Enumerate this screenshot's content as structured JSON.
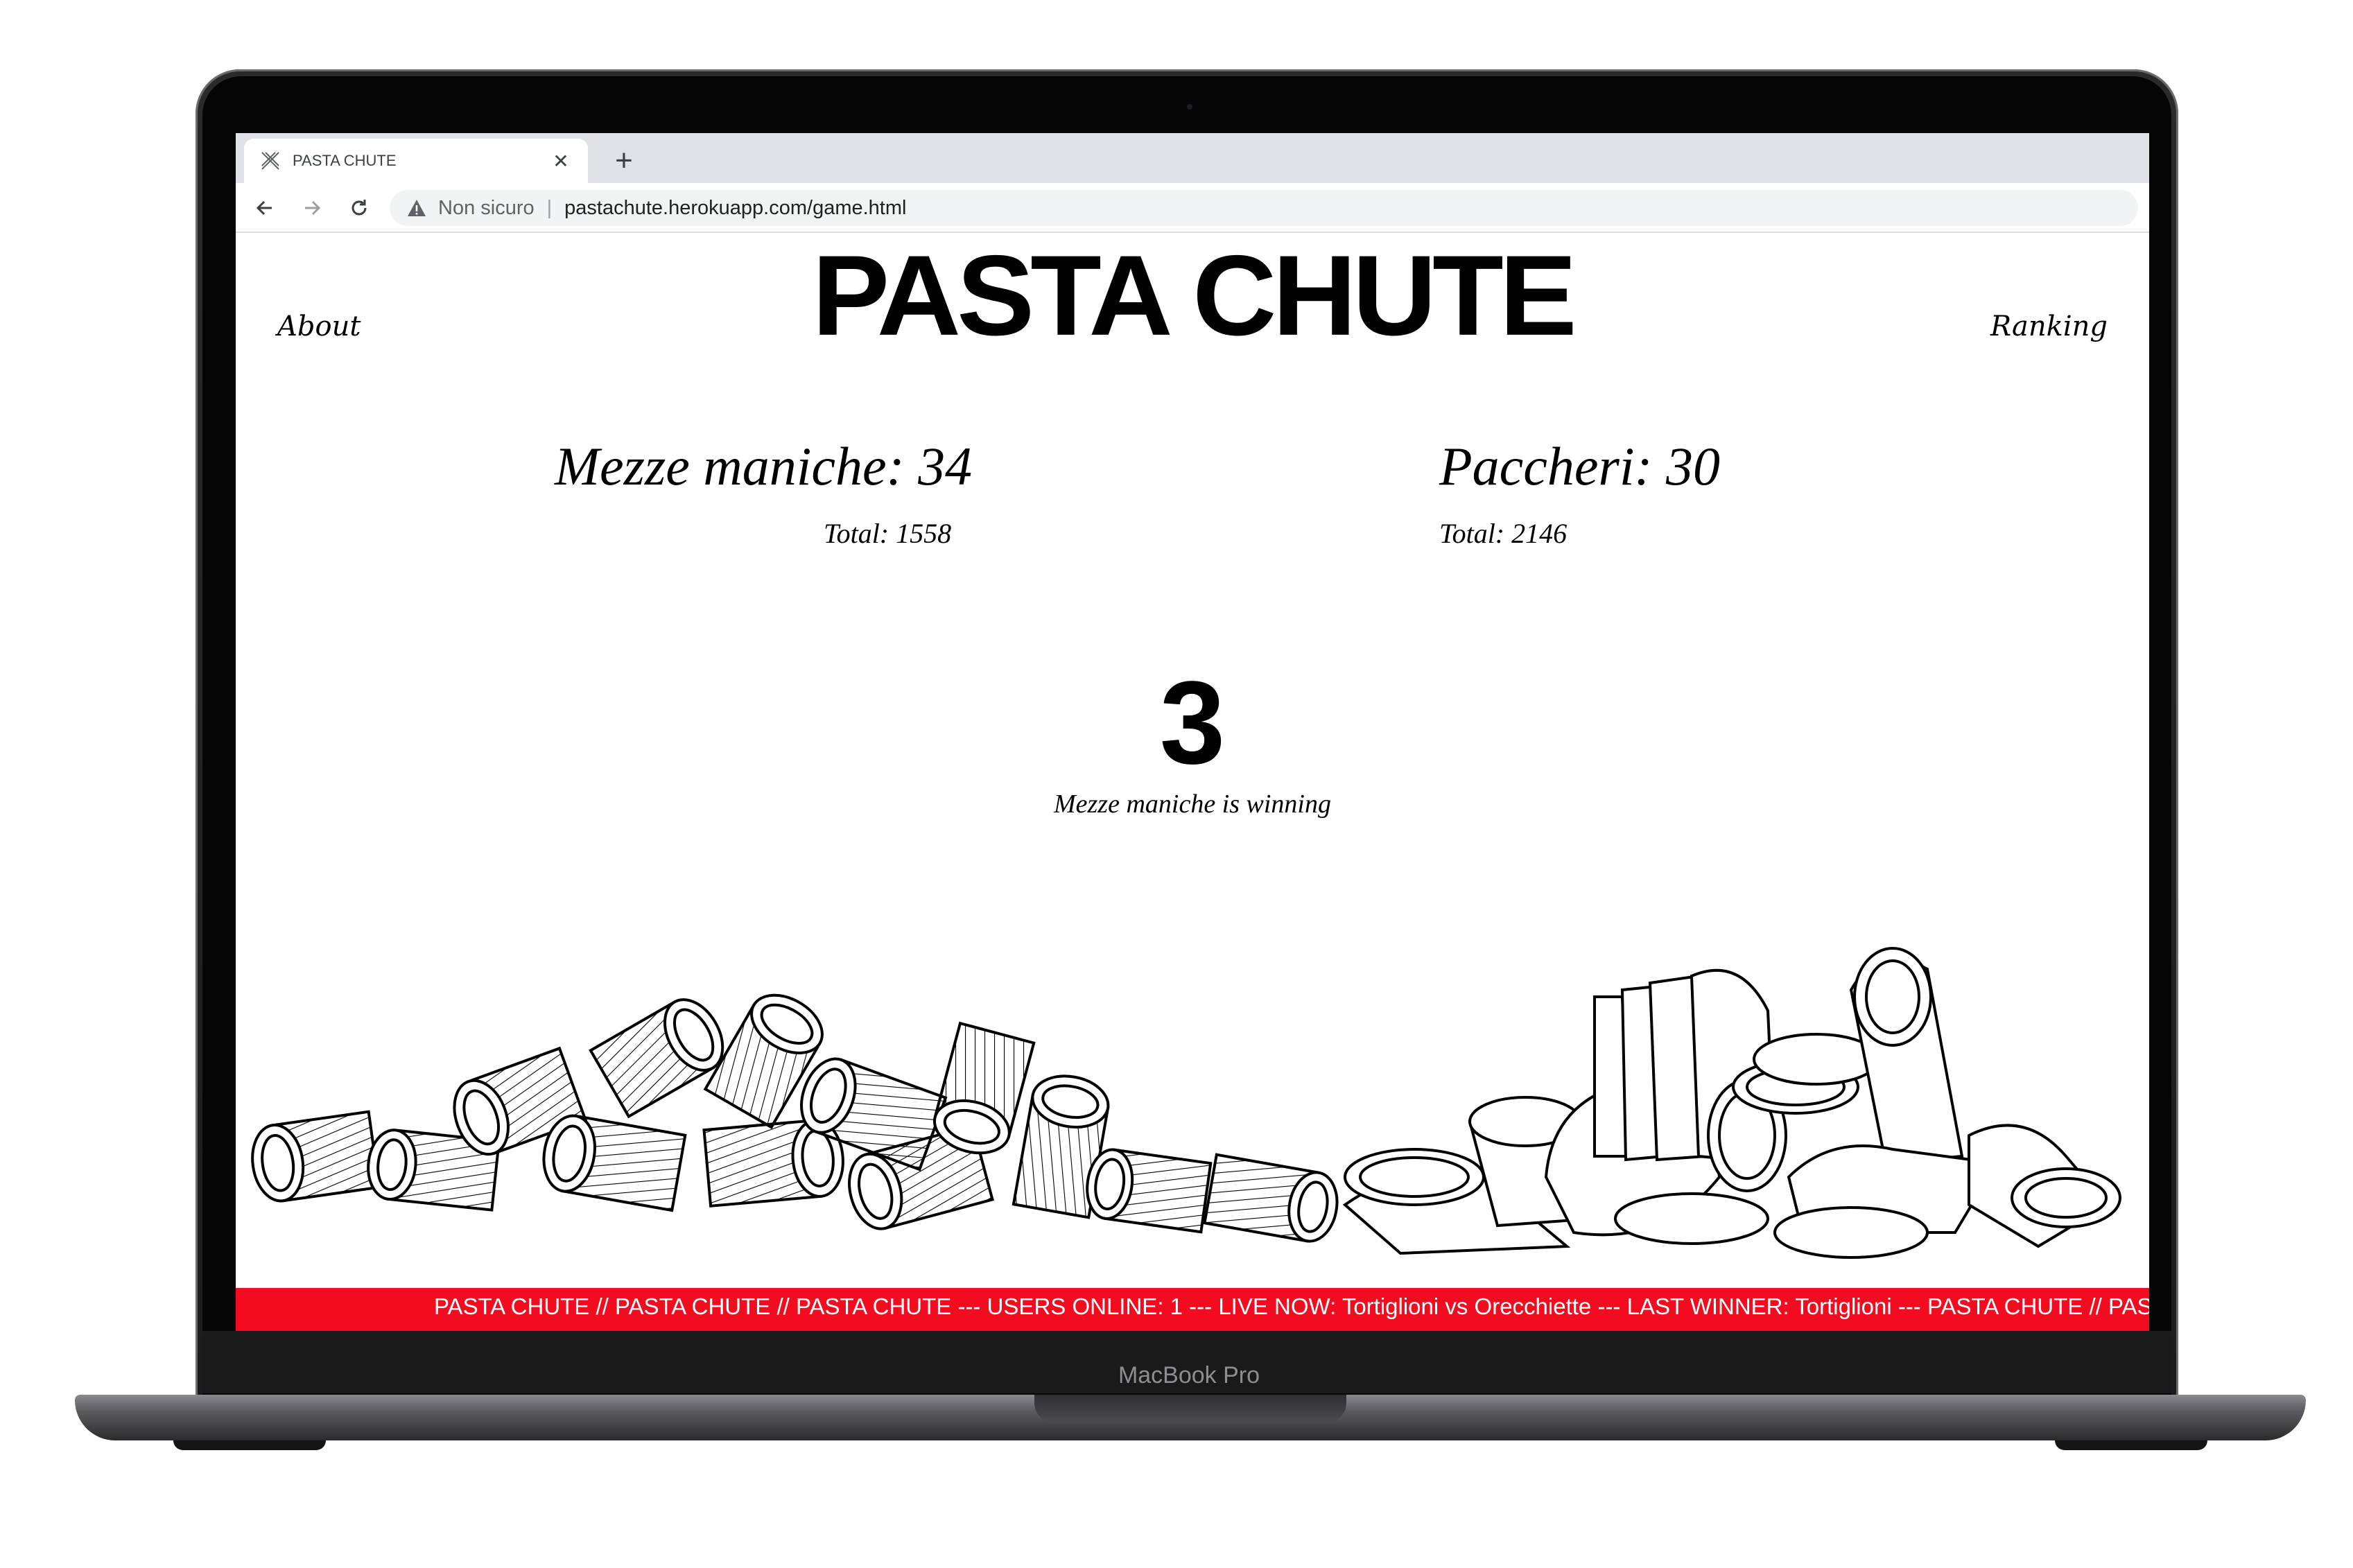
{
  "browser": {
    "tab_title": "PASTA CHUTE",
    "security_label": "Non sicuro",
    "url": "pastachute.herokuapp.com/game.html"
  },
  "header": {
    "brand": "PASTA CHUTE",
    "nav_left": "About",
    "nav_right": "Ranking"
  },
  "match": {
    "left_team": "Mezze maniche: 34",
    "left_total": "Total: 1558",
    "right_team": "Paccheri: 30",
    "right_total": "Total: 2146",
    "countdown": "3",
    "status": "Mezze maniche is winning"
  },
  "ticker": {
    "text": "PASTA CHUTE // PASTA CHUTE // PASTA CHUTE --- USERS ONLINE: 1 --- LIVE NOW: Tortiglioni vs Orecchiette --- LAST WINNER: Tortiglioni --- PASTA CHUTE // PASTA"
  },
  "device": {
    "model_label": "MacBook Pro"
  },
  "colors": {
    "ticker_bg": "#f30c20",
    "text": "#000000"
  }
}
